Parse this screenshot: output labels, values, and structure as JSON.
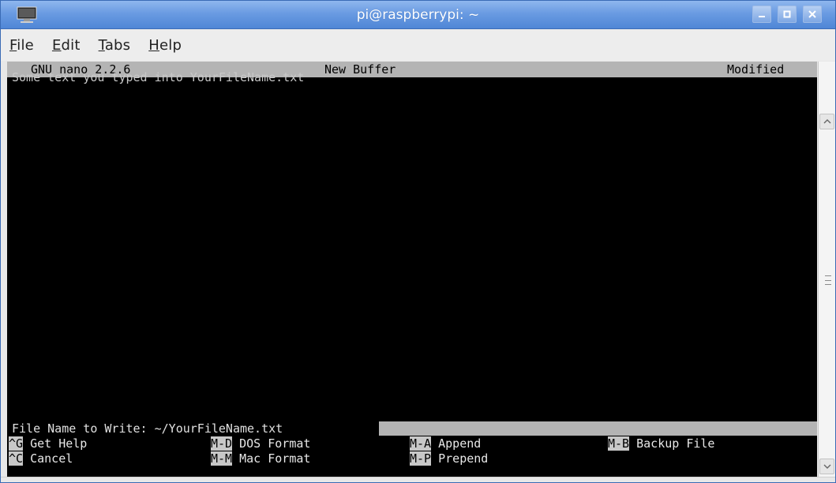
{
  "window": {
    "title": "pi@raspberrypi: ~"
  },
  "menu": {
    "items": [
      {
        "mnemonic": "F",
        "rest": "ile"
      },
      {
        "mnemonic": "E",
        "rest": "dit"
      },
      {
        "mnemonic": "T",
        "rest": "abs"
      },
      {
        "mnemonic": "H",
        "rest": "elp"
      }
    ]
  },
  "nano": {
    "version": "GNU nano 2.2.6",
    "buffer": "New Buffer",
    "status": "Modified",
    "content": "Some text you typed into YourFileName.txt",
    "prompt": "File Name to Write: ~/YourFileName.txt",
    "shortcuts": {
      "row1": [
        {
          "key": "^G",
          "label": " Get Help"
        },
        {
          "key": "M-D",
          "label": " DOS Format"
        },
        {
          "key": "M-A",
          "label": " Append"
        },
        {
          "key": "M-B",
          "label": " Backup File"
        }
      ],
      "row2": [
        {
          "key": "^C",
          "label": " Cancel"
        },
        {
          "key": "M-M",
          "label": " Mac Format"
        },
        {
          "key": "M-P",
          "label": " Prepend"
        }
      ]
    }
  },
  "colors": {
    "titlebar": "#6a9be2",
    "terminal_bg": "#000000",
    "nano_bar": "#b4b4b4"
  }
}
